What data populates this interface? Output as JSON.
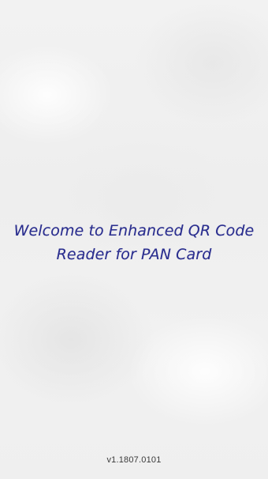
{
  "splash": {
    "welcome_line1": "Welcome to Enhanced QR Code",
    "welcome_line2": "Reader for PAN Card",
    "version": "v1.1807.0101"
  },
  "colors": {
    "welcome_text": "#2b2f8f",
    "version_text": "#3a3a3a",
    "background": "#f0f0f0"
  }
}
